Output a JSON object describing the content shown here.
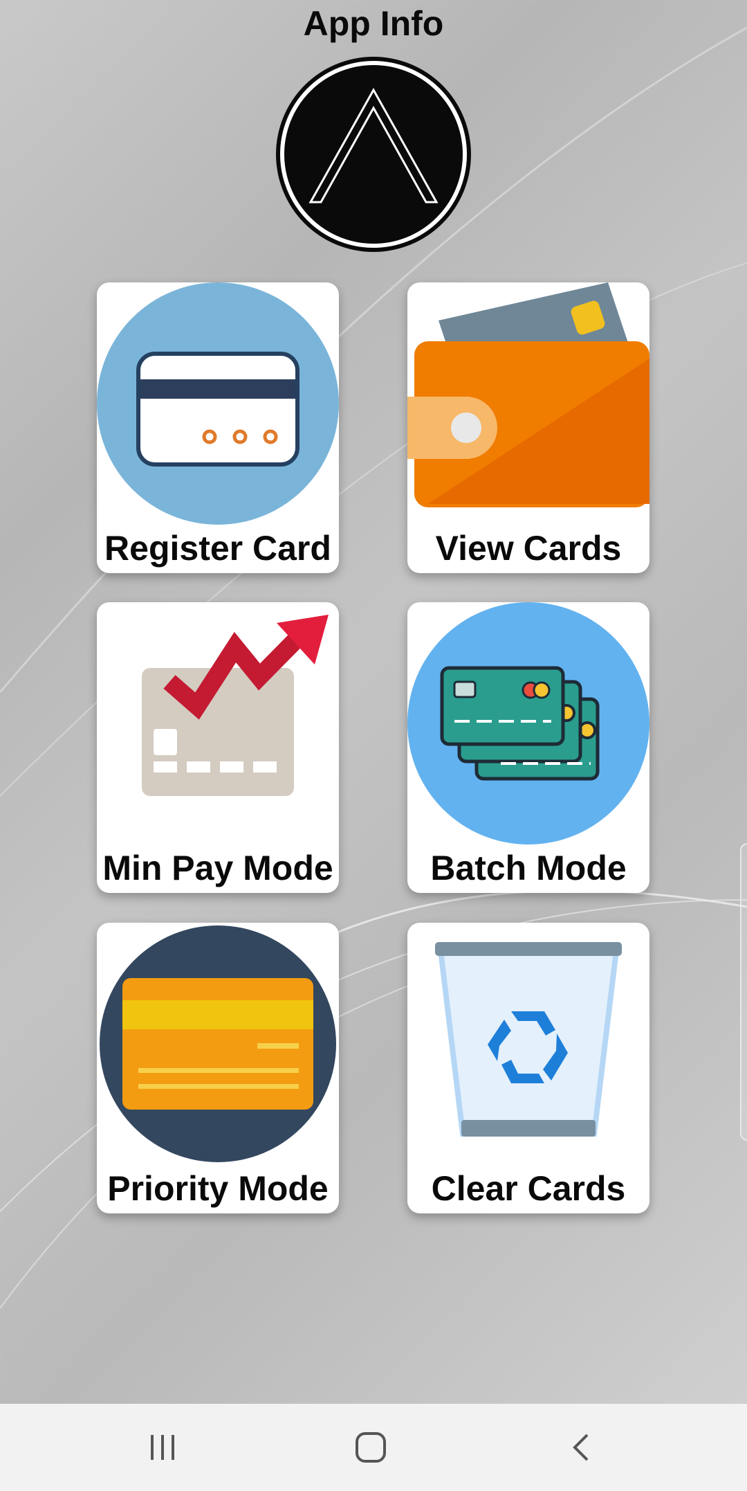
{
  "header": {
    "title": "App Info"
  },
  "logo": {
    "icon": "logo-caret-icon"
  },
  "menu": {
    "tiles": [
      {
        "label": "Register Card",
        "icon": "credit-card-icon"
      },
      {
        "label": "View Cards",
        "icon": "wallet-icon"
      },
      {
        "label": "Min Pay Mode",
        "icon": "card-trend-up-icon"
      },
      {
        "label": "Batch Mode",
        "icon": "stacked-cards-icon"
      },
      {
        "label": "Priority Mode",
        "icon": "gold-card-icon"
      },
      {
        "label": "Clear Cards",
        "icon": "recycle-bin-icon"
      }
    ]
  },
  "navbar": {
    "buttons": [
      "recent-apps-icon",
      "home-icon",
      "back-icon"
    ]
  },
  "colors": {
    "tile_background": "#ffffff",
    "wallet_orange": "#f07c00",
    "batch_blue": "#62b2ef",
    "priority_navy": "#33475f"
  }
}
